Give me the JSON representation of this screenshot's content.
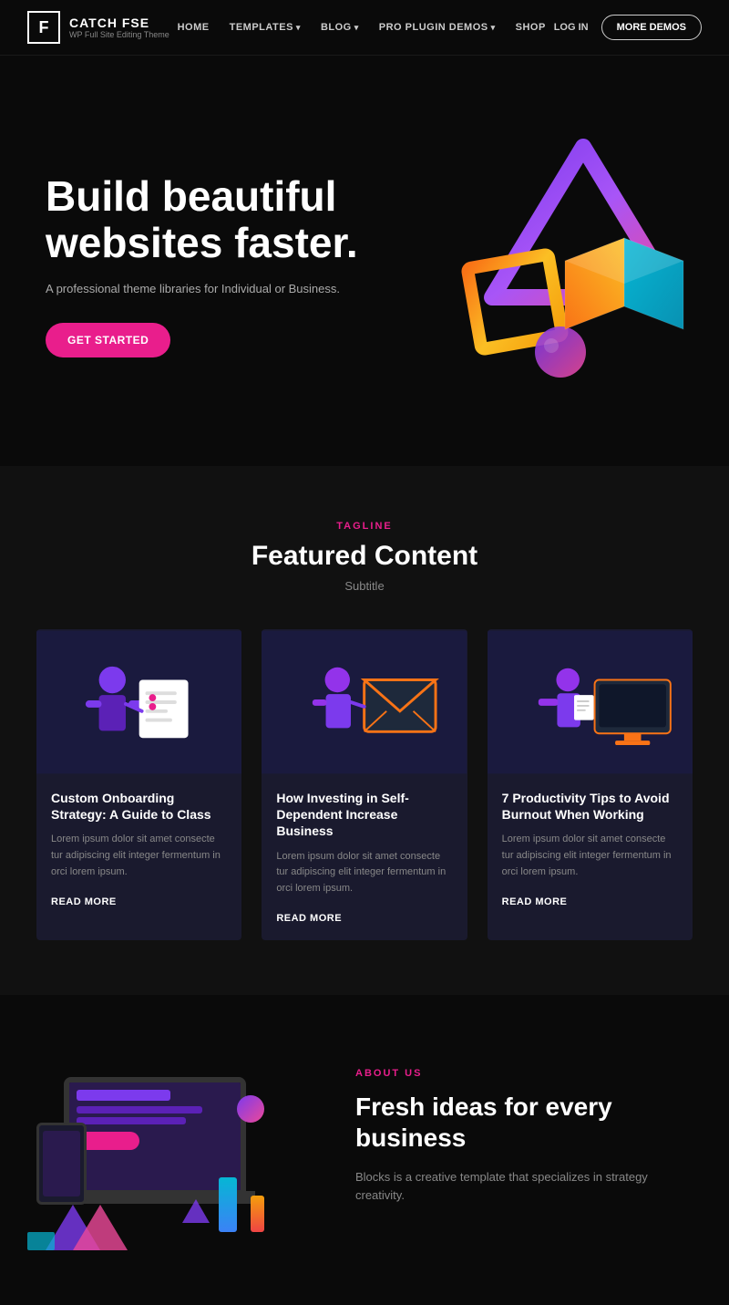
{
  "header": {
    "logo_letter": "F",
    "logo_name": "CATCH FSE",
    "logo_subtitle": "WP Full Site Editing Theme",
    "nav": [
      {
        "label": "HOME",
        "has_arrow": false
      },
      {
        "label": "TEMPLATES",
        "has_arrow": true
      },
      {
        "label": "BLOG",
        "has_arrow": true
      },
      {
        "label": "PRO PLUGIN DEMOS",
        "has_arrow": true
      },
      {
        "label": "SHOP",
        "has_arrow": false
      }
    ],
    "login_label": "LOG IN",
    "more_demos_label": "MORE DEMOS"
  },
  "hero": {
    "title": "Build beautiful websites faster.",
    "subtitle": "A professional theme libraries for Individual or Business.",
    "cta_label": "GET STARTED"
  },
  "featured": {
    "label": "TAGLINE",
    "title": "Featured Content",
    "subtitle": "Subtitle",
    "cards": [
      {
        "title": "Custom Onboarding Strategy: A Guide to Class",
        "text": "Lorem ipsum dolor sit amet consecte tur adipiscing elit integer fermentum in orci lorem ipsum.",
        "read_more": "READ MORE",
        "bg": "#1a1a3e"
      },
      {
        "title": "How Investing in Self-Dependent Increase Business",
        "text": "Lorem ipsum dolor sit amet consecte tur adipiscing elit integer fermentum in orci lorem ipsum.",
        "read_more": "READ MORE",
        "bg": "#1a1a3e"
      },
      {
        "title": "7 Productivity Tips to Avoid Burnout When Working",
        "text": "Lorem ipsum dolor sit amet consecte tur adipiscing elit integer fermentum in orci lorem ipsum.",
        "read_more": "READ MORE",
        "bg": "#1a1a3e"
      }
    ]
  },
  "about": {
    "label": "ABOUT US",
    "title": "Fresh ideas for every business",
    "text": "Blocks is a creative template that specializes in strategy creativity."
  },
  "colors": {
    "accent": "#e91e8c",
    "bg_dark": "#0a0a0a",
    "bg_mid": "#111111"
  }
}
